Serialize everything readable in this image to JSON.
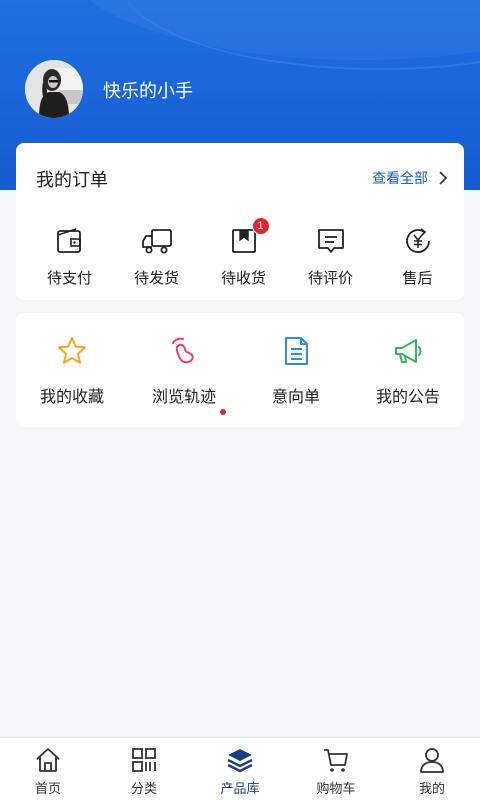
{
  "profile": {
    "username": "快乐的小手"
  },
  "orders": {
    "title": "我的订单",
    "view_all": "查看全部",
    "items": [
      {
        "label": "待支付",
        "icon": "wallet-icon"
      },
      {
        "label": "待发货",
        "icon": "truck-icon"
      },
      {
        "label": "待收货",
        "icon": "package-icon",
        "badge": "1"
      },
      {
        "label": "待评价",
        "icon": "comment-icon"
      },
      {
        "label": "售后",
        "icon": "yuan-refund-icon"
      }
    ]
  },
  "shortcuts": {
    "items": [
      {
        "label": "我的收藏",
        "icon": "star-icon"
      },
      {
        "label": "浏览轨迹",
        "icon": "footprint-icon",
        "dot": true
      },
      {
        "label": "意向单",
        "icon": "document-icon"
      },
      {
        "label": "我的公告",
        "icon": "megaphone-icon"
      }
    ]
  },
  "tabbar": {
    "active": "产品库",
    "tabs": [
      {
        "label": "首页",
        "icon": "home-icon"
      },
      {
        "label": "分类",
        "icon": "category-icon"
      },
      {
        "label": "产品库",
        "icon": "layers-icon"
      },
      {
        "label": "购物车",
        "icon": "cart-icon"
      },
      {
        "label": "我的",
        "icon": "user-icon"
      }
    ]
  },
  "colors": {
    "header": "#1a63d8",
    "link": "#1a5fb8",
    "badge": "#e8232f",
    "star": "#f5a623",
    "footprint": "#ee3f6e",
    "document": "#2f8de4",
    "megaphone": "#35b85a",
    "tab_active": "#1b3f86"
  }
}
